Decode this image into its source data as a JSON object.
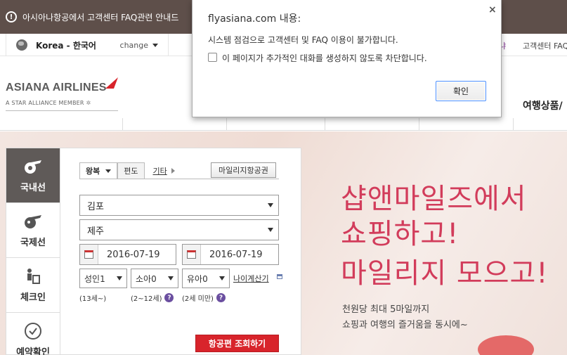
{
  "notice": {
    "text": "아시아나항공에서 고객센터 FAQ관련 안내드"
  },
  "util": {
    "lang_current": "Korea - 한국어",
    "lang_change": "change",
    "right_partial": "냐",
    "right_link": "고객센터 FAQ"
  },
  "header": {
    "logo_name": "ASIANA AIRLINES",
    "logo_sub": "A STAR ALLIANCE MEMBER",
    "nav_partial": "여행상품/"
  },
  "tabs": [
    {
      "label": "국내선",
      "icon": "domestic-plane-icon",
      "active": true
    },
    {
      "label": "국제선",
      "icon": "international-plane-icon",
      "active": false
    },
    {
      "label": "체크인",
      "icon": "checkin-icon",
      "active": false
    },
    {
      "label": "예약확인",
      "icon": "clock-check-icon",
      "active": false
    }
  ],
  "booking": {
    "trip_roundtrip": "왕복",
    "trip_oneway": "편도",
    "trip_etc": "기타",
    "mileage_button": "마일리지항공권",
    "departure": "김포",
    "arrival": "제주",
    "date_depart": "2016-07-19",
    "date_return": "2016-07-19",
    "adult": "성인1",
    "child": "소아0",
    "infant": "유아0",
    "age_calc": "나이계산기",
    "hint_adult": "(13세~)",
    "hint_child": "(2~12세)",
    "hint_infant": "(2세 미만)",
    "hint_q": "?",
    "search_button": "항공편 조회하기"
  },
  "promo": {
    "line1": "샵앤마일즈에서",
    "line2": "쇼핑하고!",
    "line3": "마일리지 모으고!",
    "sub1": "천원당 최대 5마일까지",
    "sub2": "쇼핑과 여행의 즐거움을 동시에~",
    "accent_color": "#d23c5b"
  },
  "dialog": {
    "title": "flyasiana.com 내용:",
    "close": "×",
    "message": "시스템 점검으로 고객센터 및 FAQ 이용이 불가합니다.",
    "checkbox_label": "이 페이지가 추가적인 대화를 생성하지 않도록 차단합니다.",
    "ok_button": "확인"
  }
}
